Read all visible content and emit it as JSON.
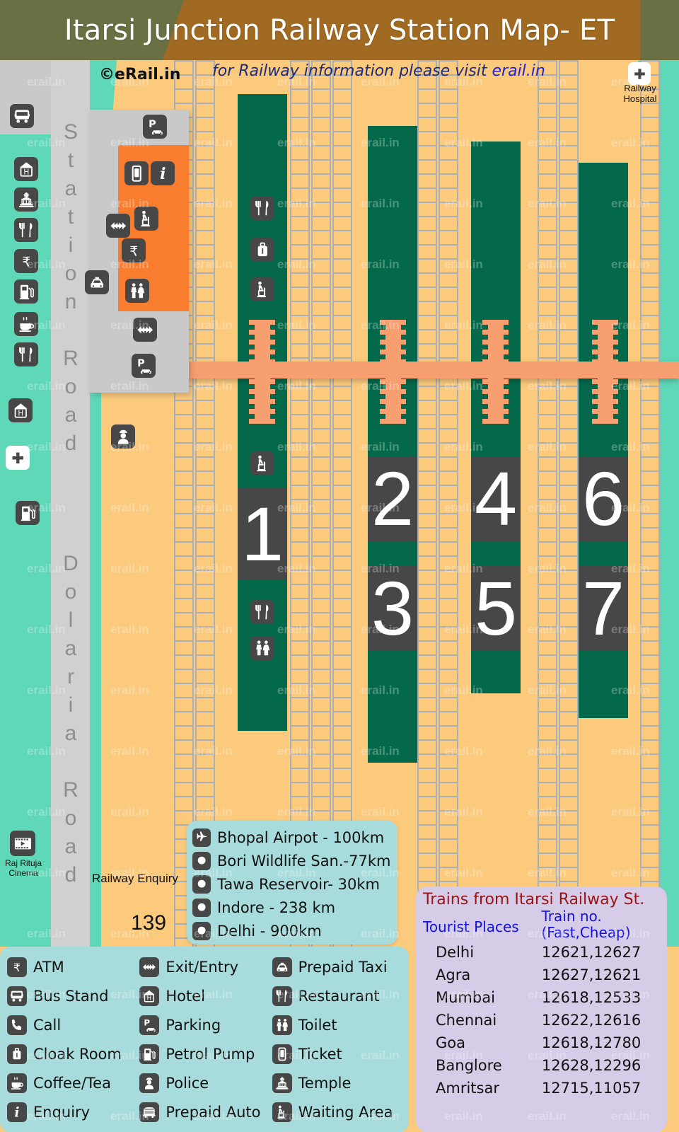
{
  "header": {
    "title": "Itarsi Junction Railway Station Map- ET"
  },
  "map": {
    "copyright": "©eRail.in",
    "visit_prefix": "for Railway information please visit ",
    "visit_site": "erail.in",
    "hospital_label": "Railway\nHospital",
    "cinema_label": "Raj Rituja\nCinema",
    "enquiry_label": "Railway Enquiry",
    "enquiry_number": "139",
    "roads": [
      {
        "name": "Station Road",
        "label": "Station Road"
      },
      {
        "name": "Dolaria Road",
        "label": "Dolaria Road"
      }
    ],
    "platforms": [
      {
        "number": "1"
      },
      {
        "number": "2"
      },
      {
        "number": "3"
      },
      {
        "number": "4"
      },
      {
        "number": "5"
      },
      {
        "number": "6"
      },
      {
        "number": "7"
      }
    ]
  },
  "distances": {
    "items": [
      {
        "icon": "airplane-icon",
        "label": "Bhopal Airpot - 100km"
      },
      {
        "icon": "dot-icon",
        "label": "Bori Wildlife San.-77km"
      },
      {
        "icon": "dot-icon",
        "label": "Tawa Reservoir- 30km"
      },
      {
        "icon": "dot-icon",
        "label": "Indore - 238 km"
      },
      {
        "icon": "dot-icon",
        "label": "Delhi - 900km"
      }
    ]
  },
  "trains": {
    "title": "Trains from Itarsi Railway St.",
    "col1_header": "Tourist Places",
    "col2_header_line1": "Train no.",
    "col2_header_line2": "(Fast,Cheap)",
    "rows": [
      {
        "place": "Delhi",
        "trains": "12621,12627"
      },
      {
        "place": "Agra",
        "trains": "12627,12621"
      },
      {
        "place": "Mumbai",
        "trains": "12618,12533"
      },
      {
        "place": "Chennai",
        "trains": "12622,12616"
      },
      {
        "place": "Goa",
        "trains": "12618,12780"
      },
      {
        "place": "Banglore",
        "trains": "12628,12296"
      },
      {
        "place": "Amritsar",
        "trains": "12715,11057"
      }
    ]
  },
  "legend": {
    "columns": [
      [
        {
          "icon": "atm-icon",
          "label": "ATM"
        },
        {
          "icon": "bus-icon",
          "label": "Bus Stand"
        },
        {
          "icon": "phone-icon",
          "label": "Call"
        },
        {
          "icon": "cloakroom-icon",
          "label": "Cloak Room"
        },
        {
          "icon": "coffee-icon",
          "label": "Coffee/Tea"
        },
        {
          "icon": "info-icon",
          "label": "Enquiry"
        }
      ],
      [
        {
          "icon": "exit-entry-icon",
          "label": "Exit/Entry"
        },
        {
          "icon": "hotel-icon",
          "label": "Hotel"
        },
        {
          "icon": "parking-icon",
          "label": "Parking"
        },
        {
          "icon": "petrol-icon",
          "label": "Petrol Pump"
        },
        {
          "icon": "police-icon",
          "label": "Police"
        },
        {
          "icon": "auto-icon",
          "label": "Prepaid Auto"
        }
      ],
      [
        {
          "icon": "taxi-icon",
          "label": "Prepaid Taxi"
        },
        {
          "icon": "restaurant-icon",
          "label": "Restaurant"
        },
        {
          "icon": "toilet-icon",
          "label": "Toilet"
        },
        {
          "icon": "ticket-icon",
          "label": "Ticket"
        },
        {
          "icon": "temple-icon",
          "label": "Temple"
        },
        {
          "icon": "waiting-icon",
          "label": "Waiting Area"
        }
      ]
    ]
  },
  "colors": {
    "platform_green": "#04694A",
    "background_orange": "#FBCA7D",
    "teal": "#5FD8B8",
    "road_gray": "#D0D0D0",
    "building_orange": "#F97D2F",
    "fob_peach": "#F89F72",
    "icon_dark": "#474747",
    "header_olive": "#6B7044",
    "header_brown": "#A06A22",
    "trains_panel": "#D6CCE8",
    "legend_panel": "#A8DCDC",
    "trains_title_red": "#9B1313",
    "trains_head_blue": "#1212E0",
    "watermark": "erail.in"
  }
}
